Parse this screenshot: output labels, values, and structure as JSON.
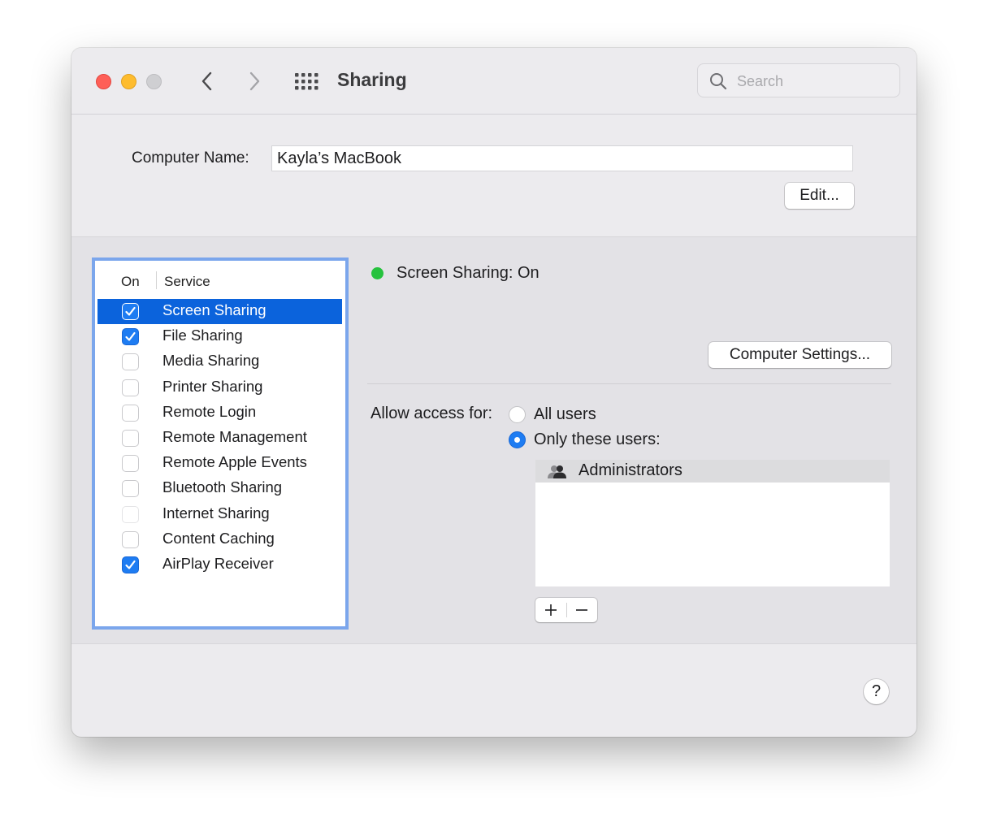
{
  "window": {
    "title": "Sharing",
    "search_placeholder": "Search"
  },
  "computer_name": {
    "label": "Computer Name:",
    "value": "Kayla’s MacBook",
    "edit_button": "Edit..."
  },
  "services": {
    "col_on": "On",
    "col_service": "Service",
    "items": [
      {
        "label": "Screen Sharing",
        "checked": true,
        "selected": true
      },
      {
        "label": "File Sharing",
        "checked": true,
        "selected": false
      },
      {
        "label": "Media Sharing",
        "checked": false,
        "selected": false
      },
      {
        "label": "Printer Sharing",
        "checked": false,
        "selected": false
      },
      {
        "label": "Remote Login",
        "checked": false,
        "selected": false
      },
      {
        "label": "Remote Management",
        "checked": false,
        "selected": false
      },
      {
        "label": "Remote Apple Events",
        "checked": false,
        "selected": false
      },
      {
        "label": "Bluetooth Sharing",
        "checked": false,
        "selected": false
      },
      {
        "label": "Internet Sharing",
        "checked": false,
        "selected": false,
        "disabled": true
      },
      {
        "label": "Content Caching",
        "checked": false,
        "selected": false
      },
      {
        "label": "AirPlay Receiver",
        "checked": true,
        "selected": false
      }
    ]
  },
  "detail": {
    "status": "Screen Sharing: On",
    "status_color": "#26c23e",
    "settings_button": "Computer Settings...",
    "access_label": "Allow access for:",
    "option_all": "All users",
    "option_only": "Only these users:",
    "selected_option": "only",
    "users": [
      "Administrators"
    ],
    "add_button": "+",
    "remove_button": "−"
  },
  "help_button": "?",
  "colors": {
    "accent": "#1e7cf2",
    "selection": "#0b63dc",
    "focus_ring": "#7ba6ec"
  }
}
